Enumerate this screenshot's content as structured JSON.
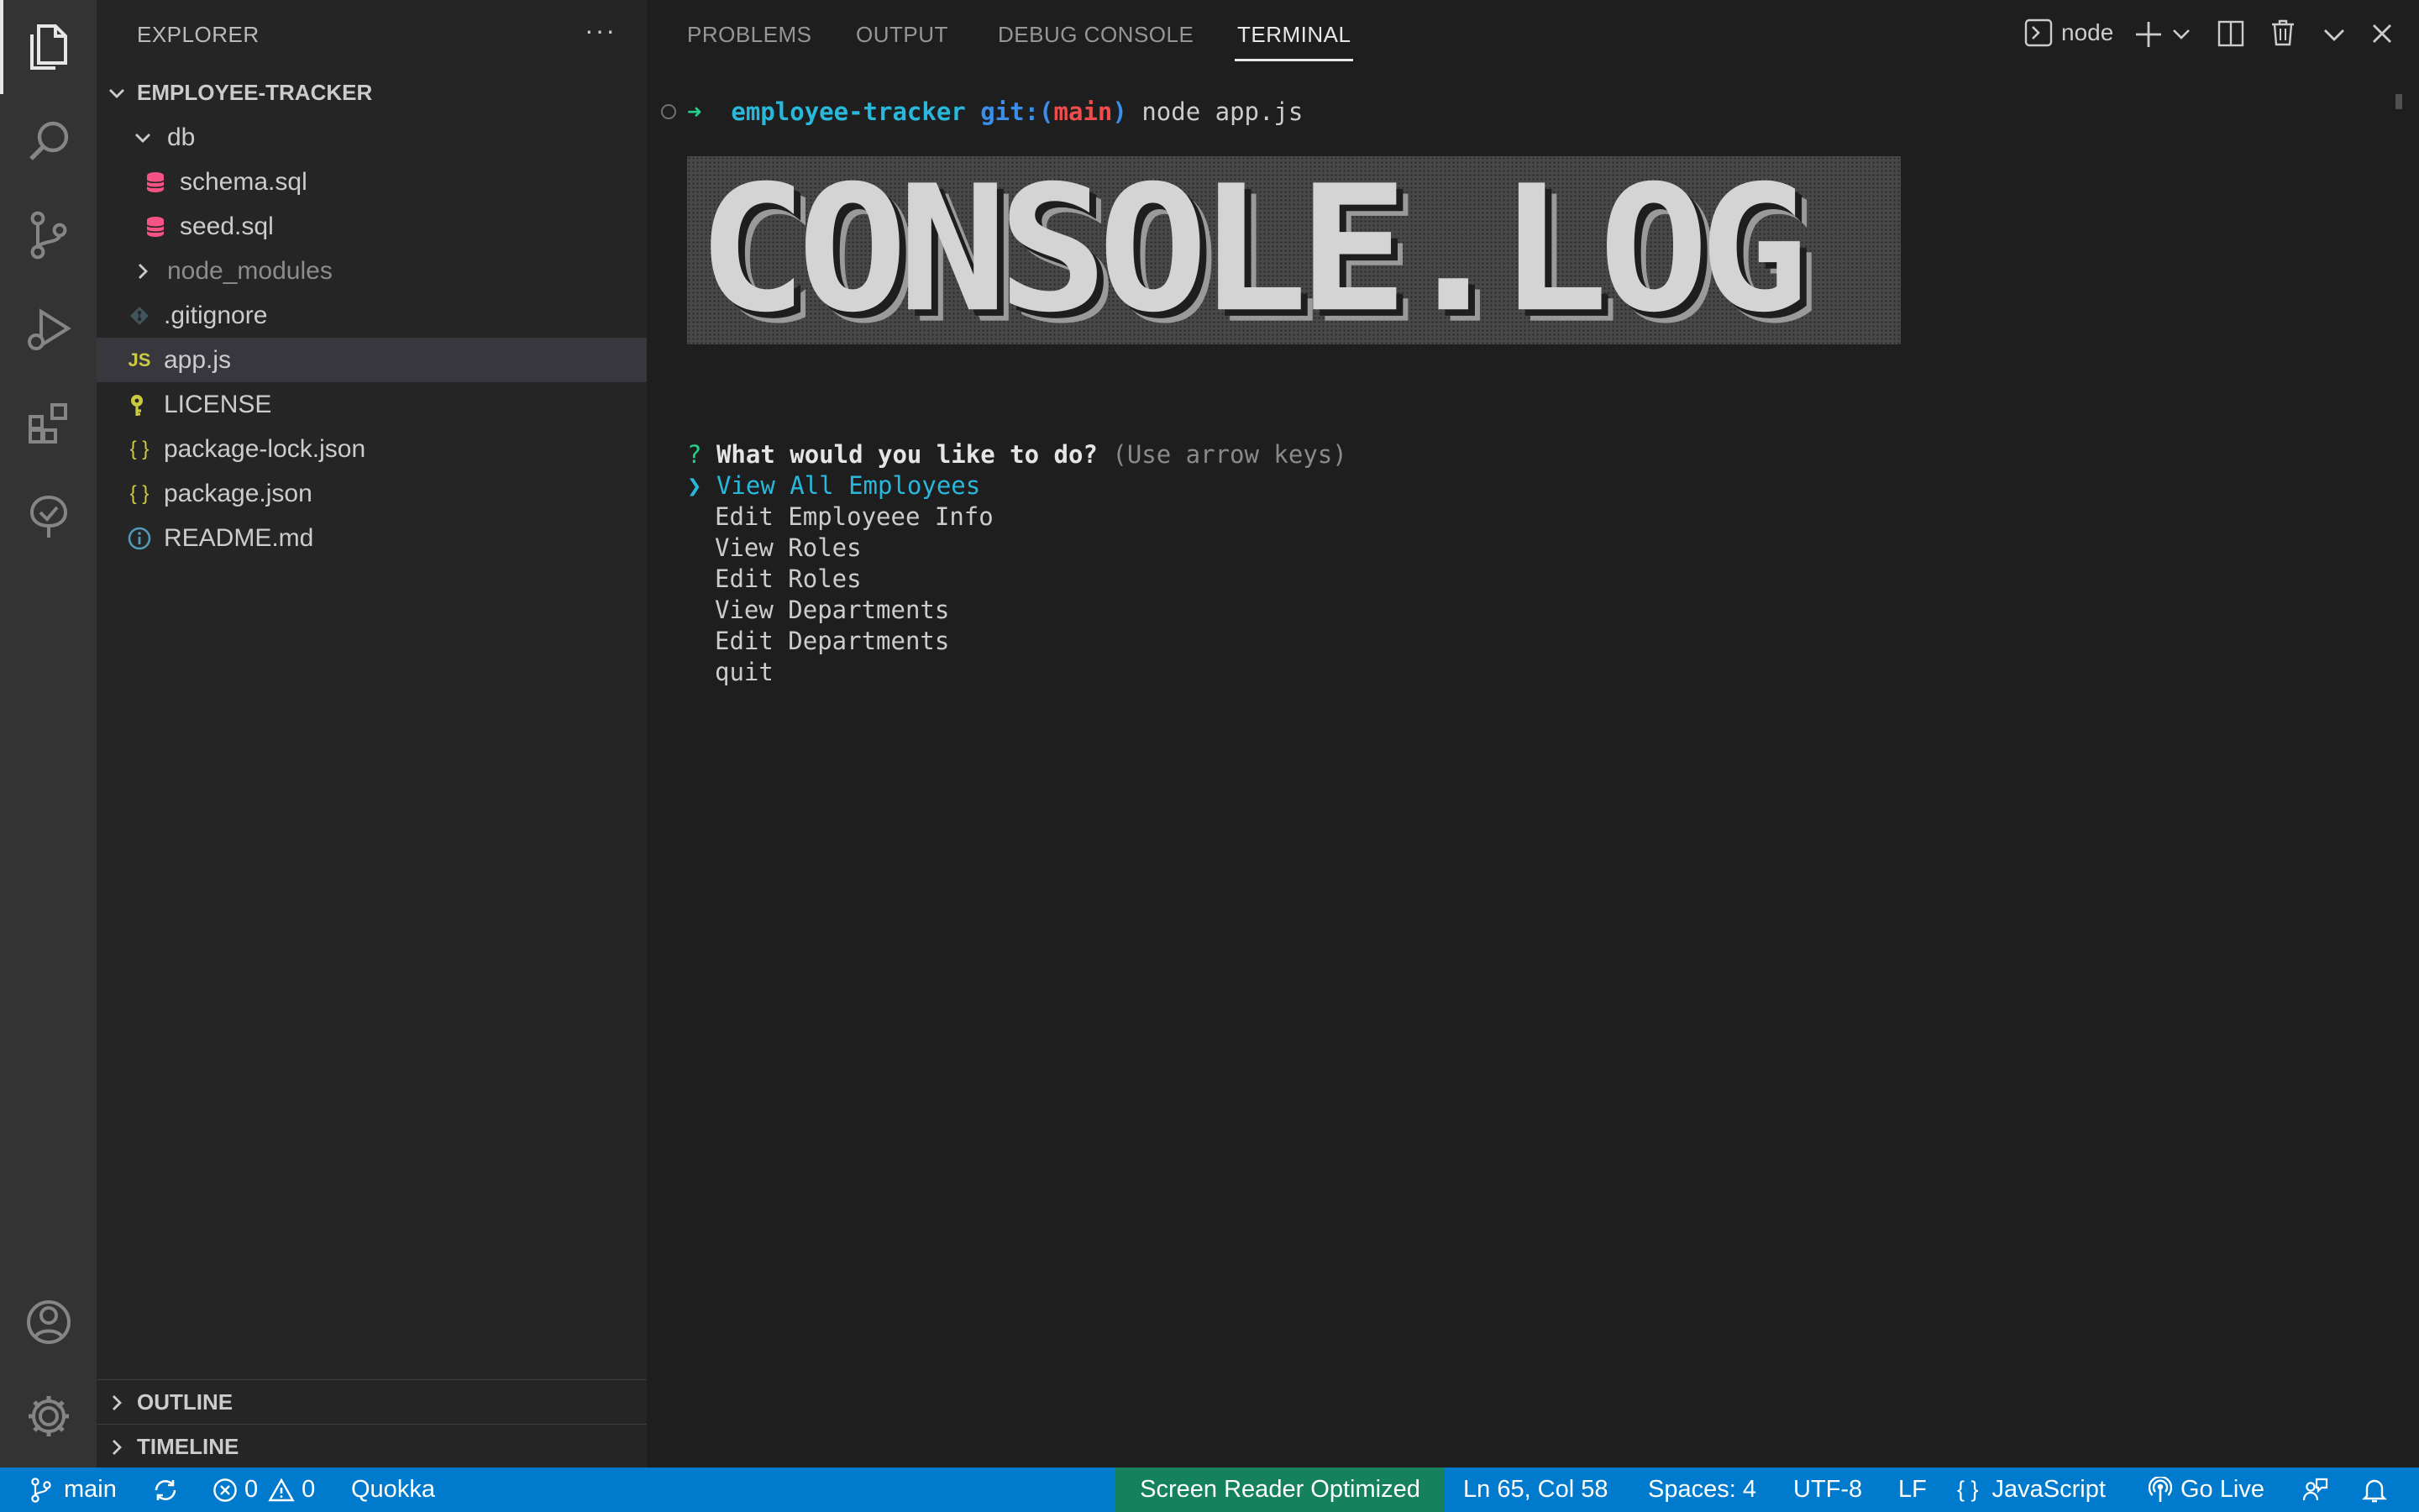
{
  "activity_bar": {
    "items": [
      {
        "icon": "explorer-files-icon"
      },
      {
        "icon": "search-icon"
      },
      {
        "icon": "source-control-icon"
      },
      {
        "icon": "run-debug-icon"
      },
      {
        "icon": "extensions-icon"
      },
      {
        "icon": "testing-icon"
      }
    ],
    "bottom": [
      {
        "icon": "accounts-icon"
      },
      {
        "icon": "manage-gear-icon"
      }
    ]
  },
  "sidebar": {
    "title": "EXPLORER",
    "more": "···",
    "project": "EMPLOYEE-TRACKER",
    "tree": [
      {
        "label": "db",
        "icon": "chevron-down-icon",
        "indent": 1
      },
      {
        "label": "schema.sql",
        "icon": "database-icon",
        "indent": 2
      },
      {
        "label": "seed.sql",
        "icon": "database-icon",
        "indent": 2
      },
      {
        "label": "node_modules",
        "icon": "chevron-right-icon",
        "indent": 1
      },
      {
        "label": ".gitignore",
        "icon": "git-icon",
        "indent": 1
      },
      {
        "label": "app.js",
        "icon": "js-file-icon",
        "indent": 1,
        "selected": true
      },
      {
        "label": "LICENSE",
        "icon": "license-key-icon",
        "indent": 1
      },
      {
        "label": "package-lock.json",
        "icon": "json-file-icon",
        "indent": 1
      },
      {
        "label": "package.json",
        "icon": "json-file-icon",
        "indent": 1
      },
      {
        "label": "README.md",
        "icon": "info-icon",
        "indent": 1
      }
    ],
    "js_badge": "JS",
    "json_badge": "{ }",
    "outline": "OUTLINE",
    "timeline": "TIMELINE"
  },
  "panel": {
    "tabs": [
      "PROBLEMS",
      "OUTPUT",
      "DEBUG CONSOLE",
      "TERMINAL"
    ],
    "active_tab": "TERMINAL",
    "terminal_name": "node"
  },
  "terminal": {
    "prompt_arrow": "➜",
    "prompt_dir": "employee-tracker",
    "prompt_git": "git:(",
    "prompt_branch": "main",
    "prompt_git_close": ")",
    "command": "node app.js",
    "banner": "CONSOLE.LOG",
    "question_mark": "?",
    "question": "What would you like to do?",
    "hint": "(Use arrow keys)",
    "pointer": "❯",
    "options": [
      "View All Employees",
      "Edit Employeee Info",
      "View Roles",
      "Edit Roles",
      "View Departments",
      "Edit Departments",
      "quit"
    ],
    "colors": {
      "prompt_green": "#23d18b",
      "dir_cyan": "#29b8db",
      "git_blue": "#3b8eea",
      "branch_red": "#f14c4c",
      "selected_cyan": "#29b8db"
    }
  },
  "status_bar": {
    "branch": "main",
    "errors": "0",
    "warnings": "0",
    "quokka": "Quokka",
    "screen_reader": "Screen Reader Optimized",
    "position": "Ln 65, Col 58",
    "spaces": "Spaces: 4",
    "encoding": "UTF-8",
    "eol": "LF",
    "lang_icon": "{ }",
    "language": "JavaScript",
    "go_live": "Go Live",
    "colors": {
      "background": "#007acc",
      "screen_reader_bg": "#16825d"
    }
  }
}
